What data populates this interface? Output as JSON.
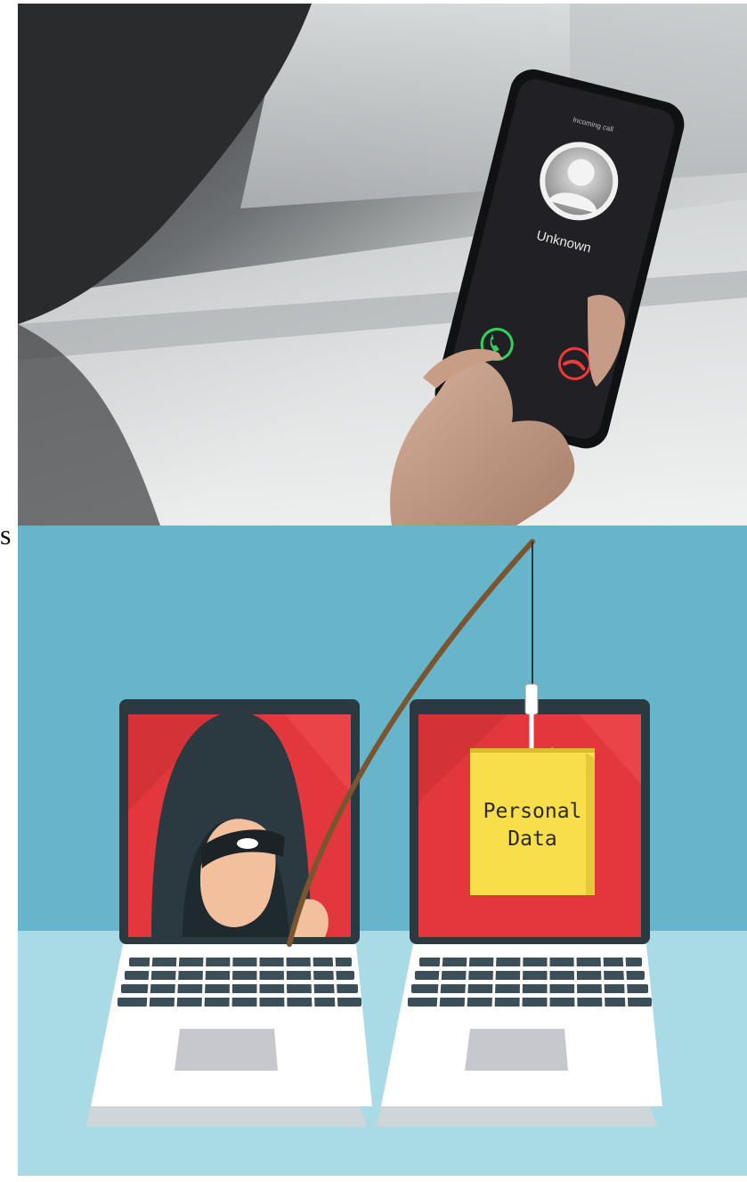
{
  "stray_glyph": "s",
  "phone_photo": {
    "call_status": "Incoming call",
    "caller_name": "Unknown",
    "icons": [
      "accept-call-icon",
      "decline-call-icon",
      "contact-avatar-icon"
    ],
    "colors": {
      "accept": "#2fd25a",
      "decline": "#f0383a",
      "screen": "#1c1d20"
    }
  },
  "phishing_illustration": {
    "note_line1": "Personal",
    "note_line2": "Data",
    "colors": {
      "background_wall": "#67b5cb",
      "desk": "#a8dbe6",
      "laptop_screen": "#e2373c",
      "note": "#f9de4c",
      "hood": "#2a3a40",
      "rod": "#7a5530"
    },
    "icons": [
      "hacker-icon",
      "fishing-rod-icon",
      "fish-hook-icon",
      "laptop-icon"
    ]
  }
}
